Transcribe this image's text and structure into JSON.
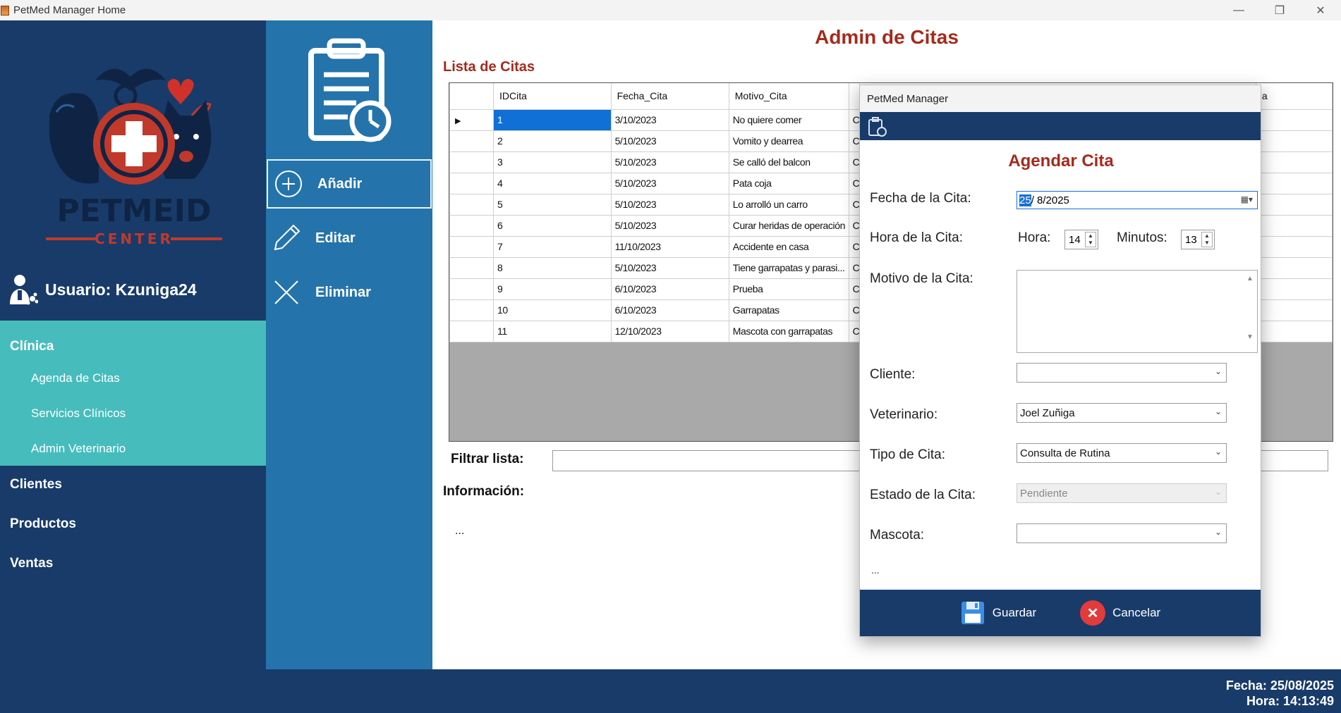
{
  "window": {
    "title": "PetMed Manager Home",
    "controls": [
      "—",
      "❐",
      "✕"
    ]
  },
  "sidebar": {
    "logo": {
      "brand": "PETMEID",
      "sub": "CENTER"
    },
    "user_label": "Usuario: Kzuniga24",
    "clinica": {
      "title": "Clínica",
      "items": [
        "Agenda de Citas",
        "Servicios Clínicos",
        "Admin Veterinario"
      ]
    },
    "menu": [
      "Clientes",
      "Productos",
      "Ventas"
    ]
  },
  "toolbar": {
    "add": "Añadir",
    "edit": "Editar",
    "delete": "Eliminar"
  },
  "main": {
    "title": "Admin de Citas",
    "list_title": "Lista de Citas",
    "columns": [
      "IDCita",
      "Fecha_Cita",
      "Motivo_Cita"
    ],
    "rows": [
      [
        "1",
        "3/10/2023",
        "No quiere comer"
      ],
      [
        "2",
        "5/10/2023",
        "Vomito y dearrea"
      ],
      [
        "3",
        "5/10/2023",
        "Se calló del balcon"
      ],
      [
        "4",
        "5/10/2023",
        "Pata coja"
      ],
      [
        "5",
        "5/10/2023",
        "Lo arrolló un carro"
      ],
      [
        "6",
        "5/10/2023",
        "Curar heridas de operación"
      ],
      [
        "7",
        "11/10/2023",
        "Accidente en casa"
      ],
      [
        "8",
        "5/10/2023",
        "Tiene garrapatas y parasi..."
      ],
      [
        "9",
        "6/10/2023",
        "Prueba"
      ],
      [
        "10",
        "6/10/2023",
        "Garrapatas"
      ],
      [
        "11",
        "12/10/2023",
        "Mascota con garrapatas"
      ]
    ],
    "hidden_col_prefix": "C",
    "hidden_header_tail": "a",
    "filter_label": "Filtrar lista:",
    "info_label": "Información:",
    "info_text": "..."
  },
  "status": {
    "fecha": "Fecha: 25/08/2025",
    "hora": "Hora: 14:13:49"
  },
  "dialog": {
    "title": "PetMed Manager",
    "heading": "Agendar Cita",
    "fecha_label": "Fecha de la Cita:",
    "fecha_day": "25",
    "fecha_rest": "/  8/2025",
    "hora_label": "Hora de la Cita:",
    "hora_sub": "Hora:",
    "hora_value": "14",
    "min_sub": "Minutos:",
    "min_value": "13",
    "motivo_label": "Motivo de la Cita:",
    "cliente_label": "Cliente:",
    "cliente_value": "",
    "vet_label": "Veterinario:",
    "vet_value": "Joel Zuñiga",
    "tipo_label": "Tipo de Cita:",
    "tipo_value": "Consulta de Rutina",
    "estado_label": "Estado de la Cita:",
    "estado_value": "Pendiente",
    "mascota_label": "Mascota:",
    "mascota_value": "",
    "dots": "...",
    "save": "Guardar",
    "cancel": "Cancelar"
  },
  "colors": {
    "navy": "#183b6a",
    "teal": "#47bcbc",
    "toolbar": "#2474ab",
    "accent_red": "#a52a1b",
    "select_blue": "#1070d6"
  }
}
